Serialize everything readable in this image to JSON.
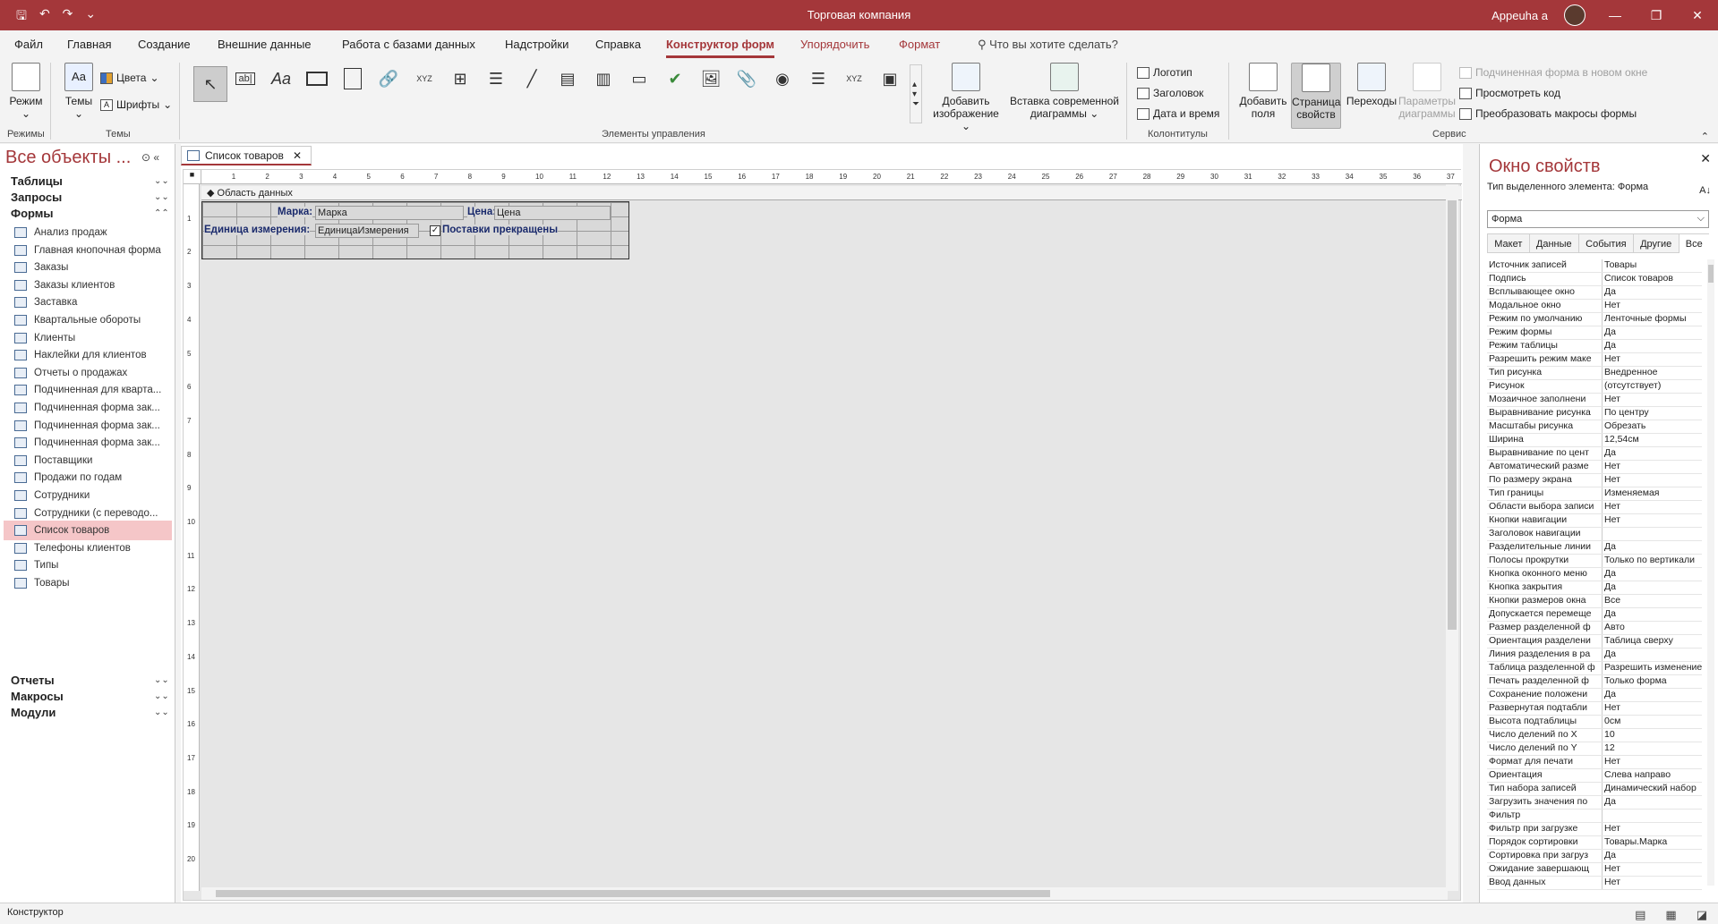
{
  "window": {
    "title": "Торговая компания",
    "user": "Appeuha a"
  },
  "menu": [
    "Файл",
    "Главная",
    "Создание",
    "Внешние данные",
    "Работа с базами данных",
    "Надстройки",
    "Справка",
    "Конструктор форм",
    "Упорядочить",
    "Формат"
  ],
  "search_placeholder": "Что вы хотите сделать?",
  "ribbon": {
    "mode": {
      "label": "Режим",
      "group": "Режимы"
    },
    "themes": {
      "label": "Темы",
      "colors": "Цвета",
      "fonts": "Шрифты",
      "group": "Темы"
    },
    "controls_group": "Элементы управления",
    "add_image": "Добавить изображение",
    "insert_chart": "Вставка современной диаграммы",
    "header": {
      "logo": "Логотип",
      "title": "Заголовок",
      "datetime": "Дата и время",
      "group": "Колонтитулы"
    },
    "tools": {
      "add_fields": "Добавить поля",
      "property_sheet": "Страница свойств",
      "tab_order": "Переходы",
      "chart_settings": "Параметры диаграммы",
      "subform_new_window": "Подчиненная форма в новом окне",
      "view_code": "Просмотреть код",
      "convert_macros": "Преобразовать макросы формы",
      "group": "Сервис"
    }
  },
  "nav": {
    "title": "Все объекты ...",
    "categories": {
      "tables": "Таблицы",
      "queries": "Запросы",
      "forms": "Формы",
      "reports": "Отчеты",
      "macros": "Макросы",
      "modules": "Модули"
    },
    "forms": [
      "Анализ продаж",
      "Главная кнопочная форма",
      "Заказы",
      "Заказы клиентов",
      "Заставка",
      "Квартальные обороты",
      "Клиенты",
      "Наклейки для клиентов",
      "Отчеты о продажах",
      "Подчиненная для кварта...",
      "Подчиненная форма зак...",
      "Подчиненная форма зак...",
      "Подчиненная форма зак...",
      "Поставщики",
      "Продажи по годам",
      "Сотрудники",
      "Сотрудники (с переводо...",
      "Список товаров",
      "Телефоны клиентов",
      "Типы",
      "Товары"
    ],
    "selected_index": 17
  },
  "document": {
    "tab": "Список товаров",
    "section": "Область данных",
    "fields": {
      "brand_label": "Марка:",
      "brand_field": "Марка",
      "price_label": "Цена:",
      "price_field": "Цена",
      "unit_label": "Единица измерения:",
      "unit_field": "ЕдиницаИзмерения",
      "discontinued_label": "Поставки прекращены"
    }
  },
  "props": {
    "title": "Окно свойств",
    "selection_label": "Тип выделенного элемента:",
    "selection_type": "Форма",
    "combo": "Форма",
    "tabs": [
      "Макет",
      "Данные",
      "События",
      "Другие",
      "Все"
    ],
    "rows": [
      [
        "Источник записей",
        "Товары"
      ],
      [
        "Подпись",
        "Список товаров"
      ],
      [
        "Всплывающее окно",
        "Да"
      ],
      [
        "Модальное окно",
        "Нет"
      ],
      [
        "Режим по умолчанию",
        "Ленточные формы"
      ],
      [
        "Режим формы",
        "Да"
      ],
      [
        "Режим таблицы",
        "Да"
      ],
      [
        "Разрешить режим маке",
        "Нет"
      ],
      [
        "Тип рисунка",
        "Внедренное"
      ],
      [
        "Рисунок",
        "(отсутствует)"
      ],
      [
        "Мозаичное заполнени",
        "Нет"
      ],
      [
        "Выравнивание рисунка",
        "По центру"
      ],
      [
        "Масштабы рисунка",
        "Обрезать"
      ],
      [
        "Ширина",
        "12,54см"
      ],
      [
        "Выравнивание по цент",
        "Да"
      ],
      [
        "Автоматический разме",
        "Нет"
      ],
      [
        "По размеру экрана",
        "Нет"
      ],
      [
        "Тип границы",
        "Изменяемая"
      ],
      [
        "Области выбора записи",
        "Нет"
      ],
      [
        "Кнопки навигации",
        "Нет"
      ],
      [
        "Заголовок навигации",
        ""
      ],
      [
        "Разделительные линии",
        "Да"
      ],
      [
        "Полосы прокрутки",
        "Только по вертикали"
      ],
      [
        "Кнопка оконного меню",
        "Да"
      ],
      [
        "Кнопка закрытия",
        "Да"
      ],
      [
        "Кнопки размеров окна",
        "Все"
      ],
      [
        "Допускается перемеще",
        "Да"
      ],
      [
        "Размер разделенной ф",
        "Авто"
      ],
      [
        "Ориентация разделени",
        "Таблица сверху"
      ],
      [
        "Линия разделения в ра",
        "Да"
      ],
      [
        "Таблица разделенной ф",
        "Разрешить изменение"
      ],
      [
        "Печать разделенной ф",
        "Только форма"
      ],
      [
        "Сохранение положени",
        "Да"
      ],
      [
        "Развернутая подтабли",
        "Нет"
      ],
      [
        "Высота подтаблицы",
        "0см"
      ],
      [
        "Число делений по X",
        "10"
      ],
      [
        "Число делений по Y",
        "12"
      ],
      [
        "Формат для печати",
        "Нет"
      ],
      [
        "Ориентация",
        "Слева направо"
      ],
      [
        "Тип набора записей",
        "Динамический набор"
      ],
      [
        "Загрузить значения по",
        "Да"
      ],
      [
        "Фильтр",
        ""
      ],
      [
        "Фильтр при загрузке",
        "Нет"
      ],
      [
        "Порядок сортировки",
        "Товары.Марка"
      ],
      [
        "Сортировка при загруз",
        "Да"
      ],
      [
        "Ожидание завершающ",
        "Нет"
      ],
      [
        "Ввод данных",
        "Нет"
      ]
    ]
  },
  "status": "Конструктор"
}
